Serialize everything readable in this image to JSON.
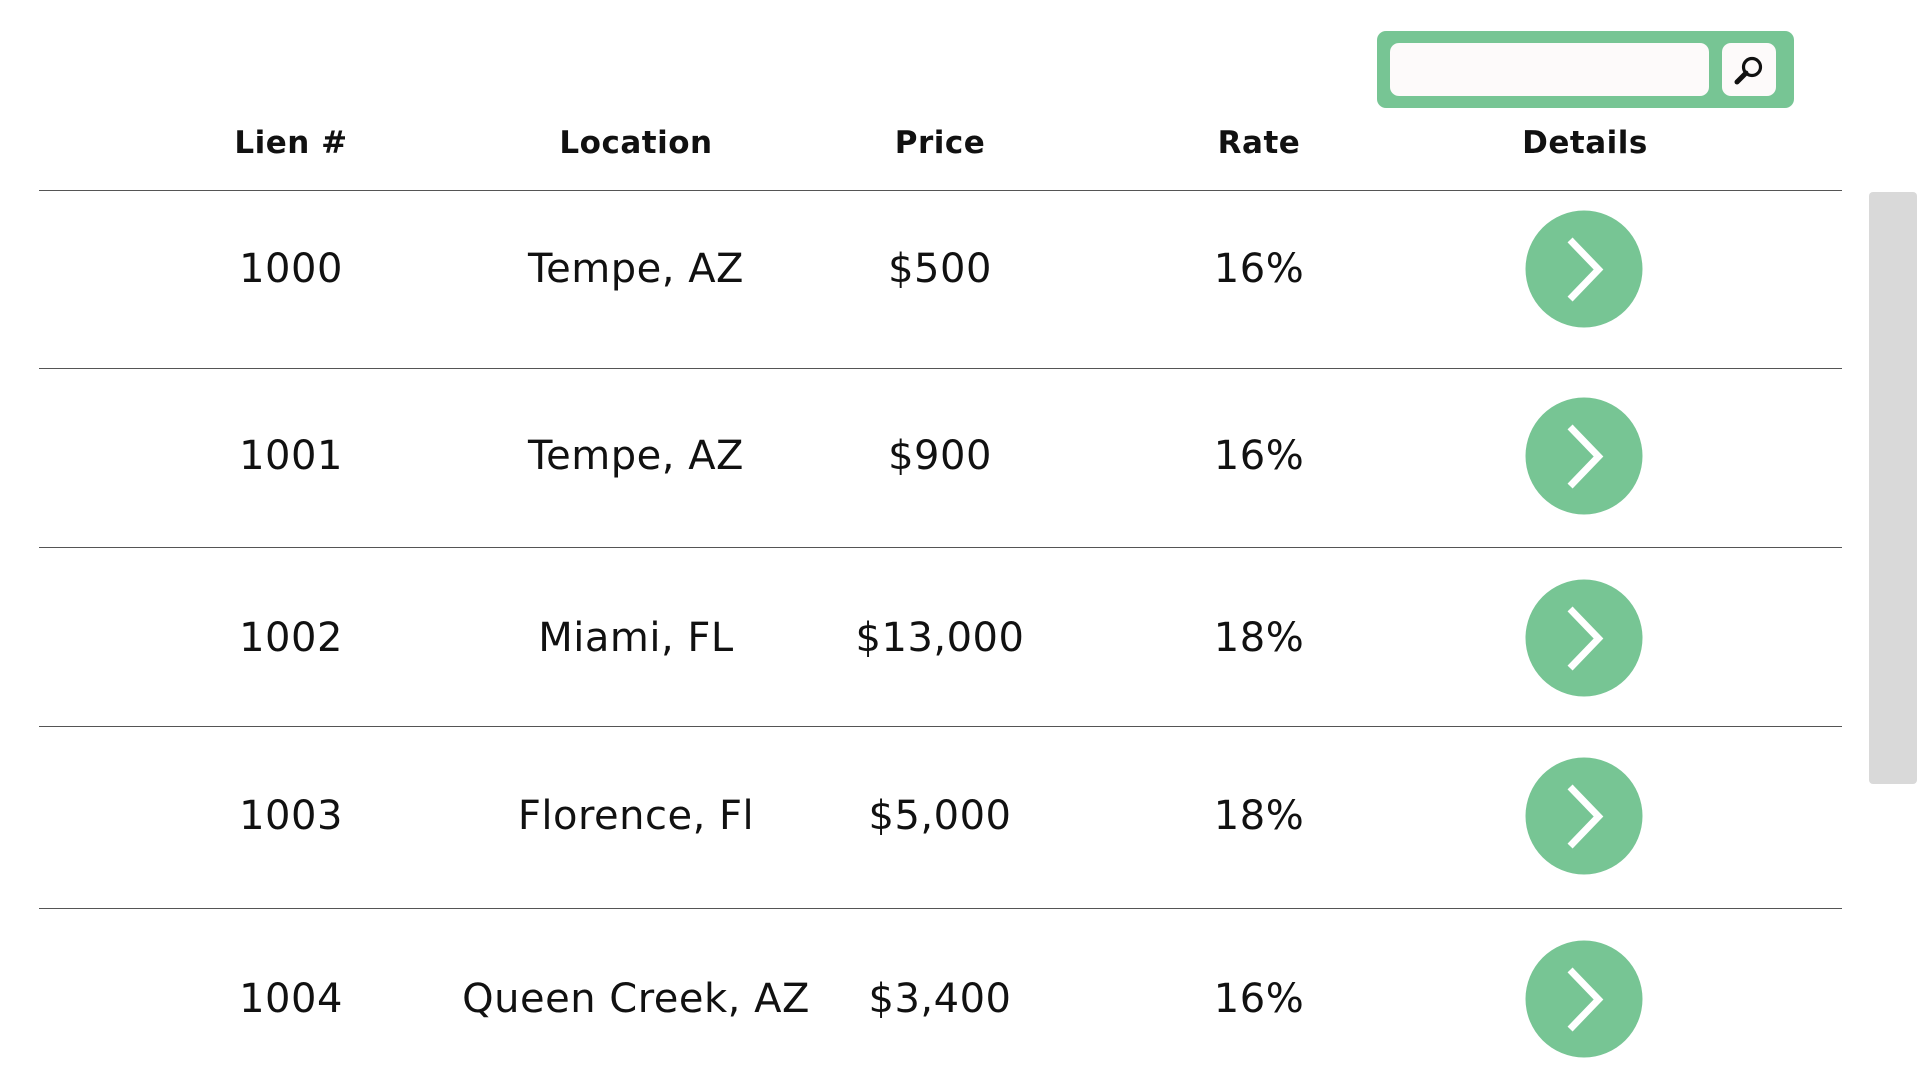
{
  "search": {
    "value": "",
    "placeholder": "",
    "icon": "magnifier-icon"
  },
  "columns": [
    "Lien #",
    "Location",
    "Price",
    "Rate",
    "Details"
  ],
  "rows": [
    {
      "lien": "1000",
      "location": "Tempe, AZ",
      "price": "$500",
      "rate": "16%"
    },
    {
      "lien": "1001",
      "location": "Tempe, AZ",
      "price": "$900",
      "rate": "16%"
    },
    {
      "lien": "1002",
      "location": "Miami, FL",
      "price": "$13,000",
      "rate": "18%"
    },
    {
      "lien": "1003",
      "location": "Florence, Fl",
      "price": "$5,000",
      "rate": "18%"
    },
    {
      "lien": "1004",
      "location": "Queen Creek, AZ",
      "price": "$3,400",
      "rate": "16%"
    }
  ],
  "details_icon": "chevron-right-icon",
  "colors": {
    "accent": "#77c594",
    "input_background": "#fdfafa",
    "scrollbar": "#d9d9d9",
    "divider": "#555555"
  }
}
